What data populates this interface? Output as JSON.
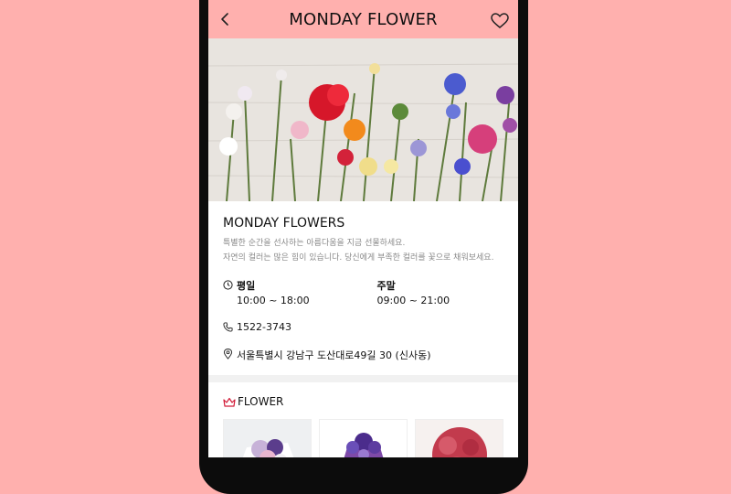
{
  "header": {
    "title": "MONDAY FLOWER",
    "back_icon": "chevron-left-icon",
    "favorite_icon": "heart-icon"
  },
  "shop": {
    "name": "MONDAY FLOWERS",
    "description_line1": "특별한 순간을 선사하는 아름다움을 지금 선물하세요.",
    "description_line2": "자연의 컬러는 많은 힘이 있습니다. 당신에게 부족한 컬러를 꽃으로 채워보세요.",
    "weekday_label": "평일",
    "weekday_hours": "10:00 ~ 18:00",
    "weekend_label": "주말",
    "weekend_hours": "09:00 ~ 21:00",
    "phone": "1522-3743",
    "address": "서울특별시 강남구 도산대로49길 30 (신사동)"
  },
  "section": {
    "title": "FLOWER"
  },
  "colors": {
    "background": "#ffb0ae",
    "header": "#ffb0ae",
    "text": "#111111",
    "muted": "#8a8a8a"
  }
}
